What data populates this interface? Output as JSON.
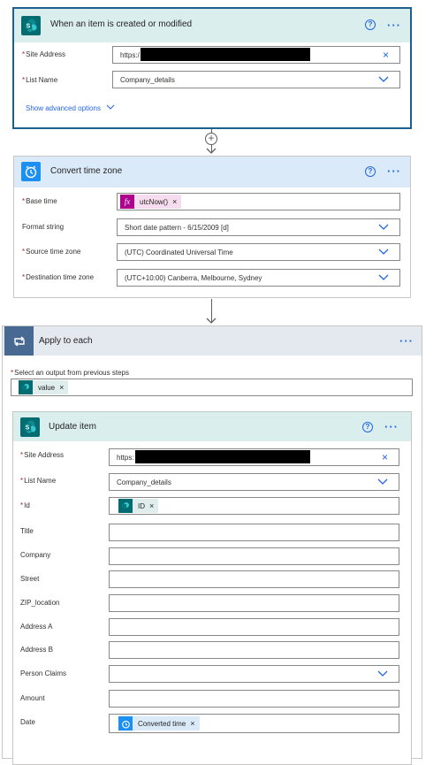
{
  "trigger": {
    "title": "When an item is created or modified",
    "site_address_label": "Site Address",
    "site_address_value": "https:/",
    "list_name_label": "List Name",
    "list_name_value": "Company_details",
    "advanced_link": "Show advanced options"
  },
  "convert": {
    "title": "Convert time zone",
    "base_time_label": "Base time",
    "base_time_token": "utcNow()",
    "format_label": "Format string",
    "format_value": "Short date pattern - 6/15/2009 [d]",
    "source_label": "Source time zone",
    "source_value": "(UTC) Coordinated Universal Time",
    "dest_label": "Destination time zone",
    "dest_value": "(UTC+10:00) Canberra, Melbourne, Sydney"
  },
  "apply": {
    "title": "Apply to each",
    "select_label": "Select an output from previous steps",
    "select_token": "value"
  },
  "update": {
    "title": "Update item",
    "site_address_label": "Site Address",
    "site_address_value": "https:",
    "list_name_label": "List Name",
    "list_name_value": "Company_details",
    "id_label": "Id",
    "id_token": "ID",
    "title_label": "Title",
    "company_label": "Company",
    "street_label": "Street",
    "zip_label": "ZIP_location",
    "address_a_label": "Address A",
    "address_b_label": "Address B",
    "person_label": "Person Claims",
    "amount_label": "Amount",
    "date_label": "Date",
    "date_token": "Converted time"
  },
  "icons": {
    "help": "?",
    "more": "···",
    "close": "×",
    "plus": "+"
  },
  "colors": {
    "sharepoint": "#036c70",
    "sharepoint_header": "#dbeeee",
    "datetime": "#1b8ff2",
    "datetime_header": "#dbeaf9",
    "control": "#486991",
    "control_header": "#e4e9ef",
    "expression": "#ad008c",
    "expression_token_bg": "#f5dcee",
    "link": "#2266e3"
  }
}
